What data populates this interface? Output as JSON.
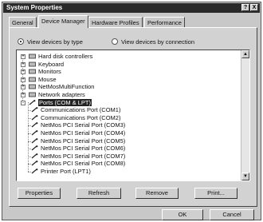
{
  "window": {
    "title": "System Properties",
    "help_glyph": "?",
    "close_glyph": "X"
  },
  "tabs": [
    "General",
    "Device Manager",
    "Hardware Profiles",
    "Performance"
  ],
  "view": {
    "by_type": "View devices by type",
    "by_connection": "View devices by connection",
    "selected": "by_type"
  },
  "tree": [
    {
      "label": "Hard disk controllers",
      "icon": "hdd-controller-icon",
      "level": 0,
      "expander": "+"
    },
    {
      "label": "Keyboard",
      "icon": "keyboard-icon",
      "level": 0,
      "expander": "+"
    },
    {
      "label": "Monitors",
      "icon": "monitor-icon",
      "level": 0,
      "expander": "+"
    },
    {
      "label": "Mouse",
      "icon": "mouse-icon",
      "level": 0,
      "expander": "+"
    },
    {
      "label": "NetMosMultiFunction",
      "icon": "device-icon",
      "level": 0,
      "expander": "+"
    },
    {
      "label": "Network adapters",
      "icon": "network-adapter-icon",
      "level": 0,
      "expander": "+"
    },
    {
      "label": "Ports (COM & LPT)",
      "icon": "port-icon",
      "level": 0,
      "expander": "-",
      "selected": true
    },
    {
      "label": "Communications Port (COM1)",
      "icon": "port-icon",
      "level": 1
    },
    {
      "label": "Communications Port (COM2)",
      "icon": "port-icon",
      "level": 1
    },
    {
      "label": "NetMos PCI Serial Port (COM3)",
      "icon": "port-icon",
      "level": 1
    },
    {
      "label": "NetMos PCI Serial Port (COM4)",
      "icon": "port-icon",
      "level": 1
    },
    {
      "label": "NetMos PCI Serial Port (COM5)",
      "icon": "port-icon",
      "level": 1
    },
    {
      "label": "NetMos PCI Serial Port (COM6)",
      "icon": "port-icon",
      "level": 1
    },
    {
      "label": "NetMos PCI Serial Port (COM7)",
      "icon": "port-icon",
      "level": 1
    },
    {
      "label": "NetMos PCI Serial Port (COM8)",
      "icon": "port-icon",
      "level": 1
    },
    {
      "label": "Printer Port (LPT1)",
      "icon": "port-icon",
      "level": 1
    }
  ],
  "actions": {
    "properties": "Properties",
    "refresh": "Refresh",
    "remove": "Remove",
    "print": "Print..."
  },
  "dialog": {
    "ok": "OK",
    "cancel": "Cancel"
  }
}
